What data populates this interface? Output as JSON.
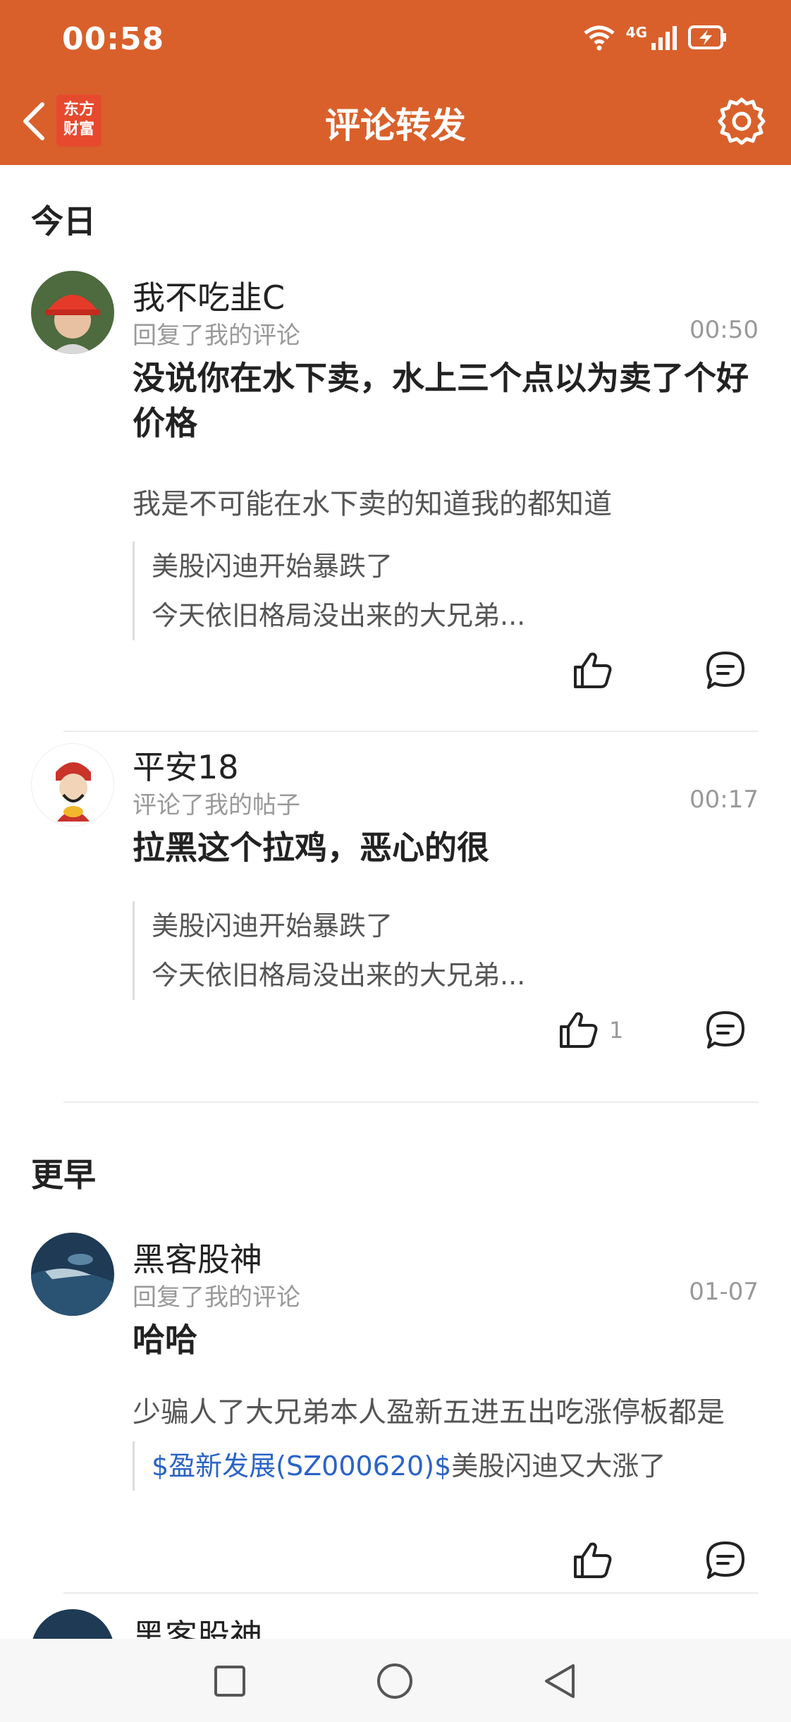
{
  "colors": {
    "accent": "#D9602B",
    "link": "#2B63C6"
  },
  "status_bar": {
    "time": "00:58",
    "network": "4G"
  },
  "header": {
    "back_icon": "chevron-left-icon",
    "logo_text": "东方\n财富",
    "title": "评论转发",
    "settings_icon": "gear-icon"
  },
  "sections": [
    {
      "title": "今日"
    },
    {
      "title": "更早"
    }
  ],
  "items": [
    {
      "name": "我不吃韭C",
      "action": "回复了我的评论",
      "time": "00:50",
      "text": "没说你在水下卖，水上三个点以为卖了个好价格",
      "reply": "我是不可能在水下卖的知道我的都知道",
      "quote_title": "美股闪迪开始暴跌了",
      "quote_sub": "今天依旧格局没出来的大兄弟..."
    },
    {
      "name": "平安18",
      "action": "评论了我的帖子",
      "time": "00:17",
      "text": "拉黑这个拉鸡，恶心的很",
      "quote_title": "美股闪迪开始暴跌了",
      "quote_sub": "今天依旧格局没出来的大兄弟...",
      "like_count": "1"
    },
    {
      "name": "黑客股神",
      "action": "回复了我的评论",
      "time": "01-07",
      "text": "哈哈",
      "reply": "少骗人了大兄弟本人盈新五进五出吃涨停板都是",
      "quote_link": "$盈新发展(SZ000620)$",
      "quote_rest": "美股闪迪又大涨了"
    },
    {
      "name": "黑客股神"
    }
  ]
}
